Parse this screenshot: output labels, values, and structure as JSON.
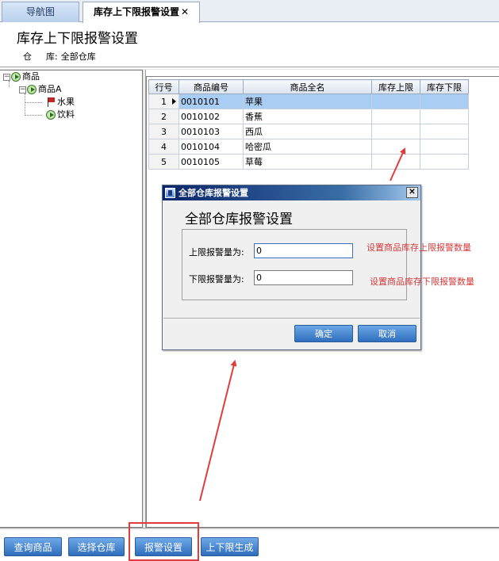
{
  "tabs": {
    "nav": "导航图",
    "active": "库存上下限报警设置",
    "close": "✕"
  },
  "page": {
    "title": "库存上下限报警设置",
    "warehouse_label_a": "仓",
    "warehouse_label_b": "库:",
    "warehouse_value": "全部仓库"
  },
  "tree": {
    "root": "商品",
    "child": "商品A",
    "leaf1": "水果",
    "leaf2": "饮料",
    "expander": "−"
  },
  "grid": {
    "headers": [
      "行号",
      "商品编号",
      "商品全名",
      "库存上限",
      "库存下限"
    ],
    "rows": [
      {
        "no": "1",
        "code": "0010101",
        "name": "苹果",
        "upper": "",
        "lower": ""
      },
      {
        "no": "2",
        "code": "0010102",
        "name": "香蕉",
        "upper": "",
        "lower": ""
      },
      {
        "no": "3",
        "code": "0010103",
        "name": "西瓜",
        "upper": "",
        "lower": ""
      },
      {
        "no": "4",
        "code": "0010104",
        "name": "哈密瓜",
        "upper": "",
        "lower": ""
      },
      {
        "no": "5",
        "code": "0010105",
        "name": "草莓",
        "upper": "",
        "lower": ""
      }
    ]
  },
  "dialog": {
    "title": "全部仓库报警设置",
    "heading": "全部仓库报警设置",
    "upper_label": "上限报警量为:",
    "upper_value": "0",
    "lower_label": "下限报警量为:",
    "lower_value": "0",
    "confirm": "确定",
    "cancel": "取消",
    "close": "✕"
  },
  "annotations": {
    "upper_note": "设置商品库存上限报警数量",
    "lower_note": "设置商品库存下限报警数量",
    "color": "#d43a3a"
  },
  "bottom": {
    "query": "查询商品",
    "select_wh": "选择仓库",
    "alarm": "报警设置",
    "generate": "上下限生成"
  },
  "colors": {
    "button_blue": "#2e6dbc",
    "selected_row": "#a9cdf3",
    "highlight_red": "#e23b3b"
  }
}
